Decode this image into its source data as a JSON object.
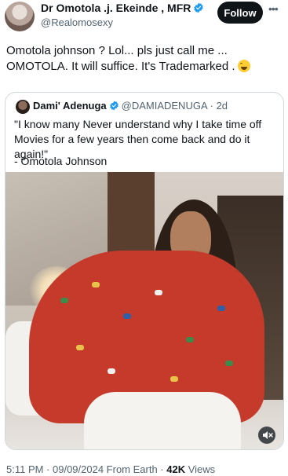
{
  "author": {
    "name": "Dr Omotola .j. Ekeinde , MFR",
    "handle": "@Realomosexy",
    "verified": true
  },
  "actions": {
    "follow_label": "Follow",
    "more_icon": "ellipsis-icon"
  },
  "tweet": {
    "text": "Omotola johnson ? Lol... pls just call me ... OMOTOLA. It will suffice. It's Trademarked .",
    "emoji": "grinning-sweat-emoji"
  },
  "quoted": {
    "name": "Dami' Adenuga",
    "handle": "@DAMIADENUGA",
    "time": "· 2d",
    "text": "\"I know many Never understand why I take time off Movies for a few years then come back and do it again!\"",
    "signature": "- Omotola Johnson",
    "video": {
      "mute_icon": "speaker-muted-icon"
    }
  },
  "meta": {
    "timestamp": "5:11 PM · 09/09/2024 From Earth · ",
    "views_count": "42K",
    "views_label": " Views"
  },
  "colors": {
    "verified": "#1d9bf0",
    "text": "#0f1419",
    "muted": "#536471",
    "border": "#cfd9de"
  }
}
